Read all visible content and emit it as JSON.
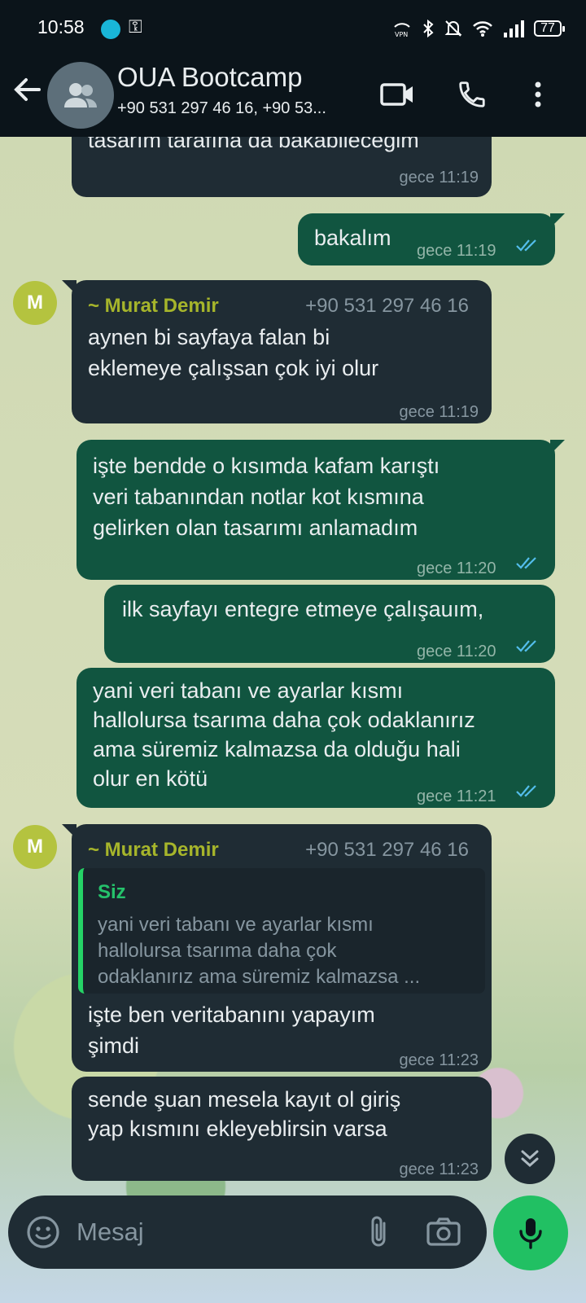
{
  "status_bar": {
    "time": "10:58",
    "battery": "77"
  },
  "header": {
    "title": "OUA Bootcamp",
    "subtitle": "+90 531 297 46 16, +90 53..."
  },
  "messages": [
    {
      "dir": "in",
      "text_lines": [
        "tasarım tarafına da bakabileceğim"
      ],
      "time": "gece 11:19"
    },
    {
      "dir": "out",
      "text_lines": [
        "bakalım"
      ],
      "time": "gece 11:19"
    },
    {
      "dir": "in",
      "sender": "~ Murat Demir",
      "phone": "+90 531 297 46 16",
      "avatar": "M",
      "text_lines": [
        "aynen bi sayfaya falan bi",
        "eklemeye çalışsan çok iyi olur"
      ],
      "time": "gece 11:19"
    },
    {
      "dir": "out",
      "text_lines": [
        "işte bendde o kısımda kafam karıştı",
        "veri tabanından notlar kot kısmına",
        "gelirken olan tasarımı anlamadım"
      ],
      "time": "gece 11:20"
    },
    {
      "dir": "out",
      "text_lines": [
        "ilk sayfayı entegre etmeye çalışauım,"
      ],
      "time": "gece 11:20"
    },
    {
      "dir": "out",
      "text_lines": [
        "yani veri tabanı ve ayarlar kısmı",
        "hallolursa tsarıma daha çok odaklanırız",
        "ama süremiz kalmazsa da olduğu hali",
        "olur en kötü"
      ],
      "time": "gece 11:21"
    },
    {
      "dir": "in",
      "sender": "~ Murat Demir",
      "phone": "+90 531 297 46 16",
      "avatar": "M",
      "quote": {
        "name": "Siz",
        "text_lines": [
          "yani veri tabanı ve ayarlar kısmı",
          "hallolursa tsarıma daha çok",
          "odaklanırız ama süremiz kalmazsa ..."
        ]
      },
      "text_lines": [
        "işte ben veritabanını yapayım",
        "şimdi"
      ],
      "time": "gece 11:23"
    },
    {
      "dir": "in",
      "text_lines": [
        "sende şuan mesela kayıt ol giriş",
        "yap kısmını ekleyeblirsin varsa"
      ],
      "time": "gece 11:23"
    }
  ],
  "input": {
    "placeholder": "Mesaj"
  },
  "colors": {
    "incoming": "#1f2c34",
    "outgoing": "#115540",
    "accent": "#21c063",
    "sender": "#a6b52b",
    "read_ticks": "#53bdeb"
  }
}
